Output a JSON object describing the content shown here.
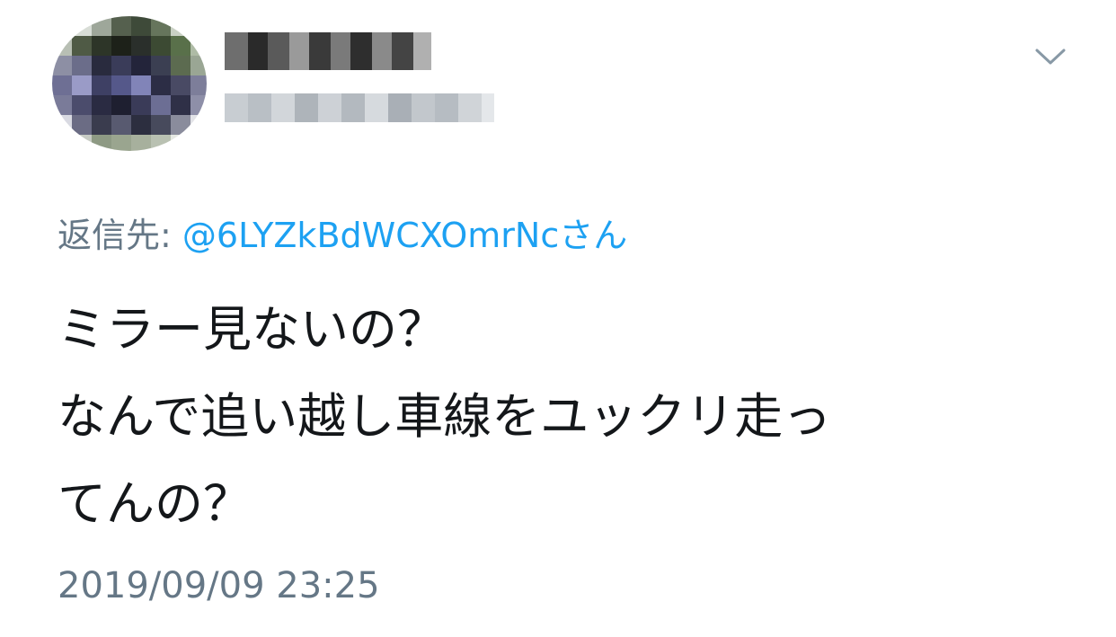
{
  "tweet": {
    "reply_prefix": "返信先: ",
    "reply_to": "@6LYZkBdWCXOmrNcさん",
    "text_lines": [
      "ミラー見ないの？",
      "なんで追い越し車線をユックリ走っ",
      "てんの？"
    ],
    "timestamp": "2019/09/09 23:25"
  },
  "icons": {
    "more_menu": "chevron-down-icon"
  },
  "colors": {
    "link": "#1da1f2",
    "secondary_text": "#657786",
    "primary_text": "#14171a",
    "background": "#ffffff"
  }
}
